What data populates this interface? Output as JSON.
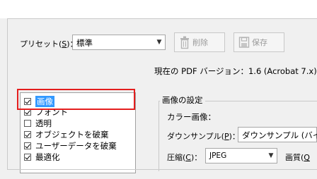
{
  "presets": {
    "label": "プリセット",
    "shortcut": "S",
    "value": "標準"
  },
  "buttons": {
    "delete": "削除",
    "save": "保存"
  },
  "version_text": "現在の PDF バージョン：1.6 (Acrobat 7.x)",
  "categories": [
    {
      "label": "画像",
      "checked": true,
      "selected": true
    },
    {
      "label": "フォント",
      "checked": true,
      "selected": false
    },
    {
      "label": "透明",
      "checked": false,
      "selected": false
    },
    {
      "label": "オブジェクトを破棄",
      "checked": true,
      "selected": false
    },
    {
      "label": "ユーザーデータを破棄",
      "checked": true,
      "selected": false
    },
    {
      "label": "最適化",
      "checked": true,
      "selected": false
    }
  ],
  "image_settings": {
    "group_title": "画像の設定",
    "color_image_label": "カラー画像：",
    "downsample_label": "ダウンサンプル",
    "downsample_shortcut": "P",
    "downsample_value": "ダウンサンプル (バイキ",
    "compression_label": "圧縮",
    "compression_shortcut": "C",
    "compression_value": "JPEG",
    "quality_label": "画質",
    "quality_shortcut": "Q"
  }
}
